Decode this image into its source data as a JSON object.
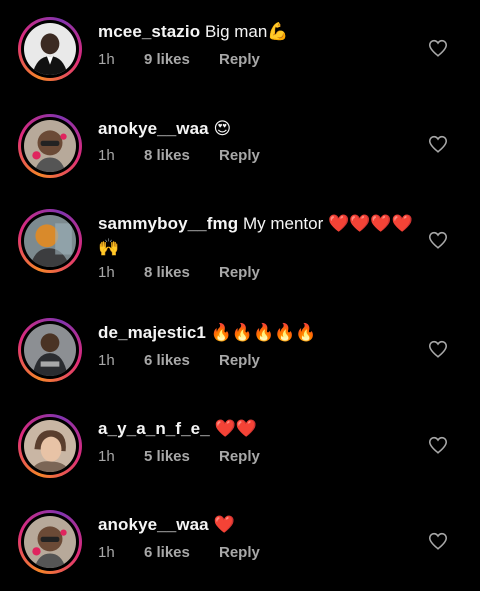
{
  "comments": [
    {
      "username": "mcee_stazio",
      "text": "Big man💪",
      "time": "1h",
      "likes": "9 likes",
      "reply": "Reply",
      "avatar": "avatar-mcee-stazio",
      "like_icon": "heart-outline-icon"
    },
    {
      "username": "anokye__waa",
      "text": "😍",
      "time": "1h",
      "likes": "8 likes",
      "reply": "Reply",
      "avatar": "avatar-anokye-waa",
      "like_icon": "heart-outline-icon"
    },
    {
      "username": "sammyboy__fmg",
      "text": "My mentor ❤️❤️❤️❤️🙌",
      "time": "1h",
      "likes": "8 likes",
      "reply": "Reply",
      "avatar": "avatar-sammyboy-fmg",
      "like_icon": "heart-outline-icon"
    },
    {
      "username": "de_majestic1",
      "text": "🔥🔥🔥🔥🔥",
      "time": "1h",
      "likes": "6 likes",
      "reply": "Reply",
      "avatar": "avatar-de-majestic1",
      "like_icon": "heart-outline-icon"
    },
    {
      "username": "a_y_a_n_f_e_",
      "text": "❤️❤️",
      "time": "1h",
      "likes": "5 likes",
      "reply": "Reply",
      "avatar": "avatar-a-y-a-n-f-e",
      "like_icon": "heart-outline-icon"
    },
    {
      "username": "anokye__waa",
      "text": "❤️",
      "time": "1h",
      "likes": "6 likes",
      "reply": "Reply",
      "avatar": "avatar-anokye-waa",
      "like_icon": "heart-outline-icon"
    }
  ],
  "colors": {
    "background": "#000000",
    "text": "#f5f5f5",
    "meta_text": "#a8a8a8",
    "story_ring_start": "#f58529",
    "story_ring_end": "#dd2a7b"
  }
}
